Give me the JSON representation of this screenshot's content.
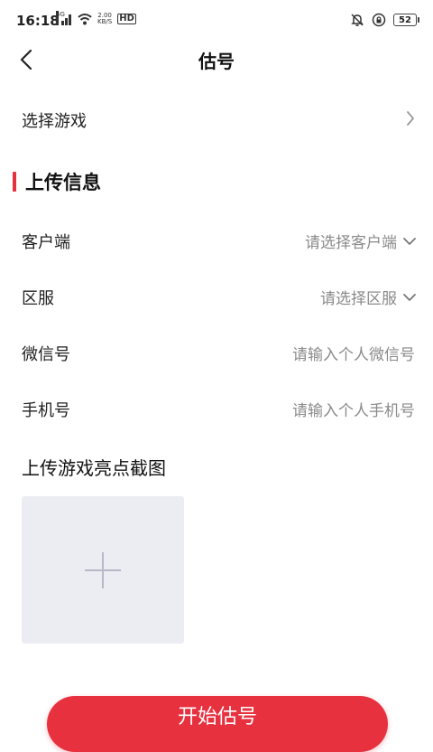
{
  "status": {
    "time": "16:18",
    "signal_tag": "4G",
    "net_speed_value": "2.00",
    "net_speed_unit": "KB/S",
    "hd": "HD",
    "battery": "52"
  },
  "nav": {
    "title": "估号"
  },
  "select_game": {
    "label": "选择游戏"
  },
  "section": {
    "title": "上传信息"
  },
  "fields": {
    "client": {
      "label": "客户端",
      "placeholder": "请选择客户端"
    },
    "server": {
      "label": "区服",
      "placeholder": "请选择区服"
    },
    "wechat": {
      "label": "微信号",
      "placeholder": "请输入个人微信号"
    },
    "phone": {
      "label": "手机号",
      "placeholder": "请输入个人手机号"
    }
  },
  "upload": {
    "title": "上传游戏亮点截图"
  },
  "primary_button": {
    "label": "开始估号"
  },
  "colors": {
    "accent": "#e8313f",
    "placeholder": "#8a8a8a",
    "upload_bg": "#ececf3"
  }
}
